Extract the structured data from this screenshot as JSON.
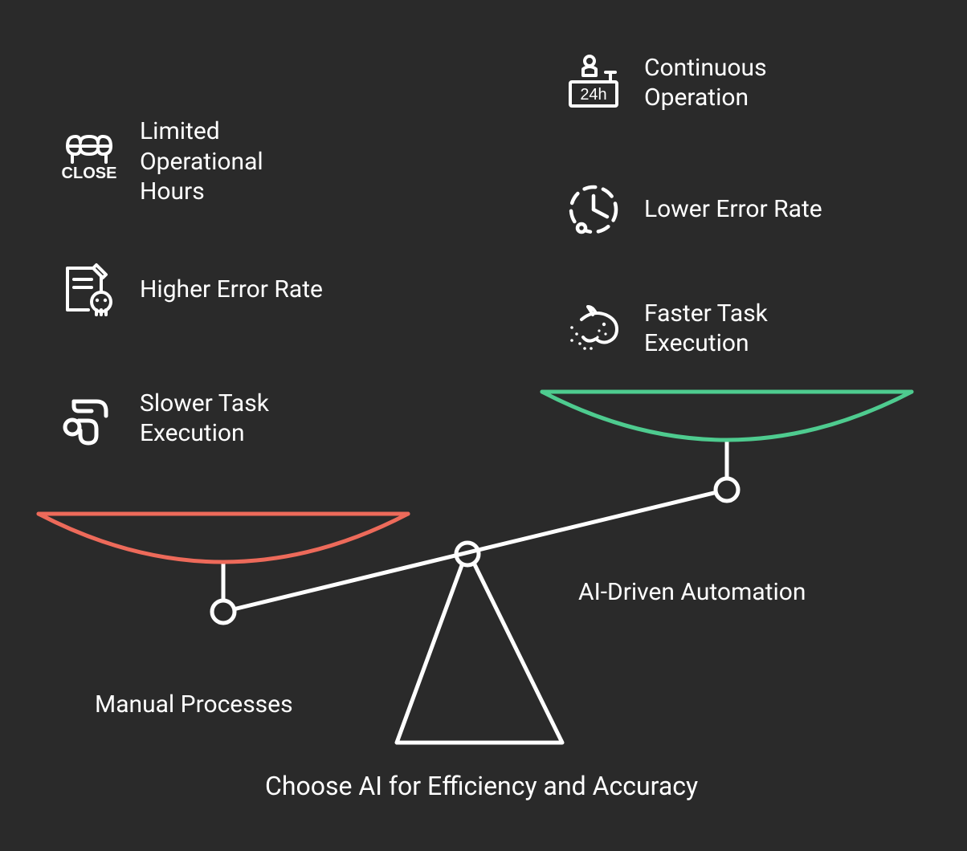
{
  "left": {
    "label": "Manual Processes",
    "color": "#ed6a5a",
    "items": [
      {
        "icon": "close-shop-icon",
        "label": "Limited\nOperational\nHours"
      },
      {
        "icon": "error-note-icon",
        "label": "Higher Error Rate"
      },
      {
        "icon": "slow-pipe-icon",
        "label": "Slower Task\nExecution"
      }
    ]
  },
  "right": {
    "label": "AI-Driven Automation",
    "color": "#4ecb8f",
    "items": [
      {
        "icon": "service-24h-icon",
        "label": "Continuous\nOperation"
      },
      {
        "icon": "low-error-icon",
        "label": "Lower Error Rate"
      },
      {
        "icon": "fast-animal-icon",
        "label": "Faster Task\nExecution"
      }
    ]
  },
  "tagline": "Choose AI for Efficiency and Accuracy",
  "colors": {
    "bg": "#2a2a2a",
    "stroke": "#ffffff"
  }
}
